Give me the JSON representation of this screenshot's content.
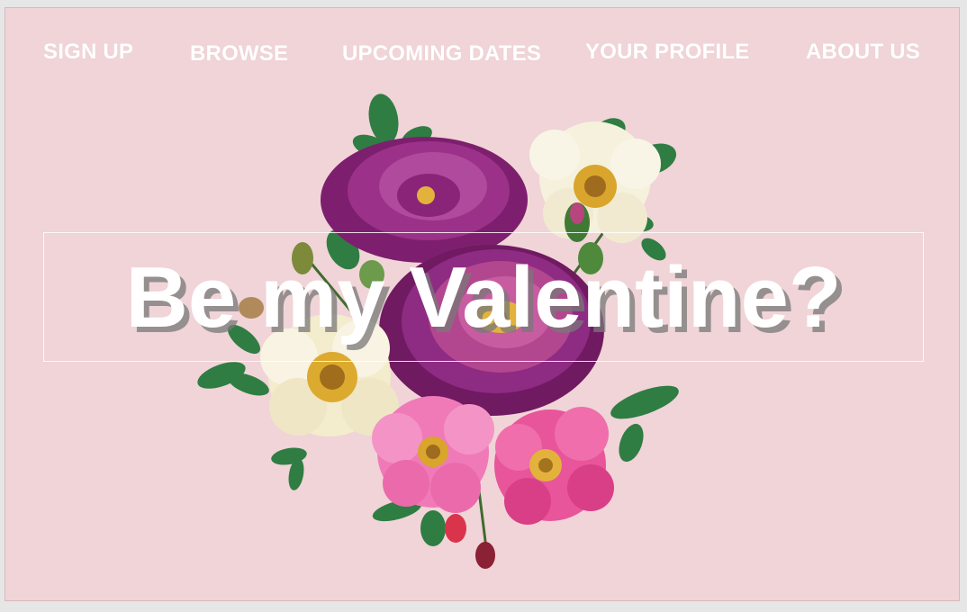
{
  "nav": {
    "items": [
      {
        "label": "SIGN UP"
      },
      {
        "label": "BROWSE"
      },
      {
        "label": "UPCOMING DATES"
      },
      {
        "label": "YOUR PROFILE"
      },
      {
        "label": "ABOUT US"
      }
    ]
  },
  "hero": {
    "headline": "Be my Valentine?",
    "image": "flower-bouquet-illustration"
  },
  "colors": {
    "background": "#f0d4d7",
    "text": "#ffffff",
    "rose_purple": "#8e2b82",
    "flower_pink": "#e8559a",
    "flower_cream": "#f6f1dc",
    "leaf_green": "#2f7d43"
  }
}
